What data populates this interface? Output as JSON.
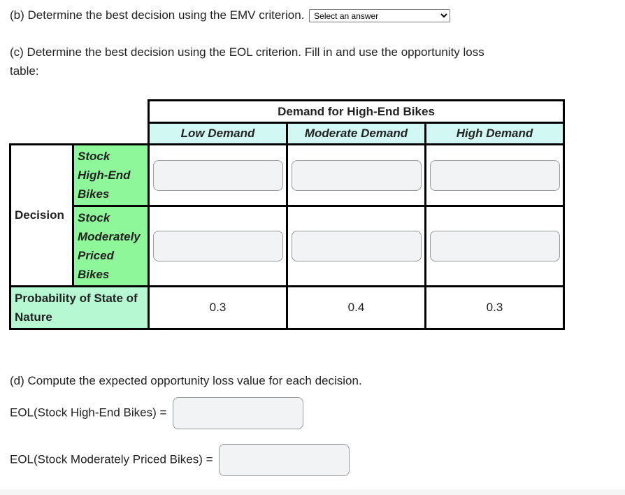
{
  "part_b": {
    "text": "(b) Determine the best decision using the EMV criterion.",
    "select": {
      "selected": "Select an answer",
      "options": [
        "Select an answer"
      ]
    }
  },
  "part_c": {
    "text": "(c) Determine the best decision using the EOL criterion. Fill in and use the opportunity loss table:"
  },
  "table": {
    "title": "Demand for High-End Bikes",
    "columns": [
      "Low Demand",
      "Moderate Demand",
      "High Demand"
    ],
    "decision_label": "Decision",
    "rows": [
      {
        "label": "Stock High-End Bikes",
        "lines": [
          "Stock",
          "High-End",
          "Bikes"
        ],
        "values": [
          "",
          "",
          ""
        ]
      },
      {
        "label": "Stock Moderately Priced Bikes",
        "lines": [
          "Stock",
          "Moderately",
          "Priced",
          "Bikes"
        ],
        "values": [
          "",
          "",
          ""
        ]
      }
    ],
    "probability_label": "Probability of State of Nature",
    "probabilities": [
      "0.3",
      "0.4",
      "0.3"
    ]
  },
  "part_d": {
    "text": "(d) Compute the expected opportunity loss value for each decision.",
    "eol_high_label": "EOL(Stock High-End Bikes) =",
    "eol_high_value": "",
    "eol_mod_label": "EOL(Stock Moderately Priced Bikes) =",
    "eol_mod_value": ""
  },
  "colors": {
    "column_header_bg": "#d2f8f3",
    "row_header_bg": "#8ef79a",
    "probability_header_bg": "#b5f8d2",
    "input_bg": "#f2f3f5"
  }
}
